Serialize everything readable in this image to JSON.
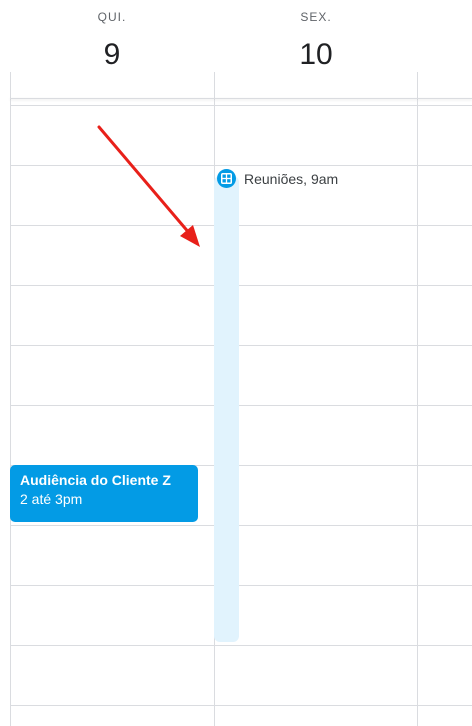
{
  "days": [
    {
      "name": "QUI.",
      "number": "9"
    },
    {
      "name": "SEX.",
      "number": "10"
    }
  ],
  "events": {
    "client_hearing": {
      "title": "Audiência do Cliente Z",
      "time": "2 até 3pm"
    },
    "meetings": {
      "title": "Reuniões",
      "separator": ", ",
      "time": "9am"
    }
  },
  "colors": {
    "event_blue": "#039be5",
    "drag_bar": "#e1f3fd",
    "grid": "#dadce0",
    "annotation_arrow": "#e8201a"
  },
  "icons": {
    "task": "grid-task-icon",
    "annotation": "red-arrow-icon"
  }
}
